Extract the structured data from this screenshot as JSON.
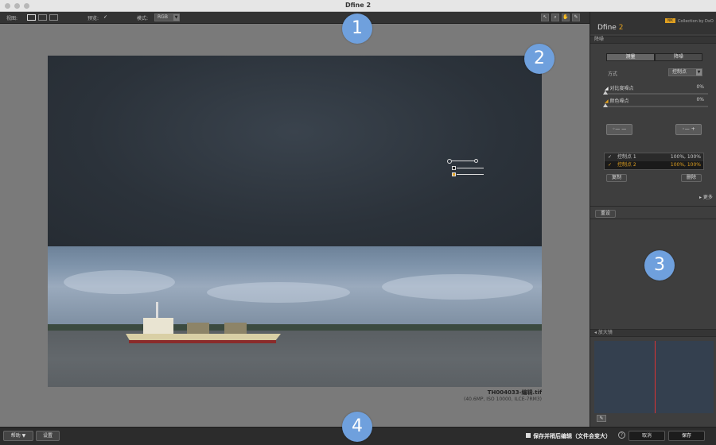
{
  "window": {
    "title": "Dfine 2"
  },
  "toolbar": {
    "view_label": "视图:",
    "preview_label": "预览:",
    "preview_check": "✓",
    "mode_label": "模式:",
    "mode_value": "RGB"
  },
  "panel": {
    "product_name": "Dfine",
    "product_version": "2",
    "logo_tag": "NIK",
    "collection": "Collection by DxO",
    "section_noise": "降噪",
    "tabs": [
      "测量",
      "降噪"
    ],
    "method_label": "方式",
    "method_value": "控制点",
    "contrast_noise_label": "对比度噪点",
    "contrast_noise_value": "0%",
    "color_noise_label": "颜色噪点",
    "color_noise_value": "0%",
    "control_points": [
      {
        "label": "控制点 1",
        "value": "100%, 100%"
      },
      {
        "label": "控制点 2",
        "value": "100%, 100%"
      }
    ],
    "copy_label": "复制",
    "delete_label": "删除",
    "more_label": "▸ 更多",
    "reset_label": "重设",
    "loupe_label": "◂ 放大镜"
  },
  "image": {
    "filename": "TH004033-编辑.tif",
    "meta": "(40.6MP, ISO 10000, ILCE-7RM3)"
  },
  "bottombar": {
    "help_label": "帮助 ▼",
    "settings_label": "设置",
    "save_later_label": "保存并稍后编辑（文件会变大）",
    "info_glyph": "?",
    "cancel_label": "取消",
    "save_label": "保存"
  },
  "markers": [
    "1",
    "2",
    "3",
    "4"
  ],
  "colors": {
    "accent": "#e0a020",
    "marker": "#6fa0dd",
    "loupe_line": "#dd3333"
  }
}
